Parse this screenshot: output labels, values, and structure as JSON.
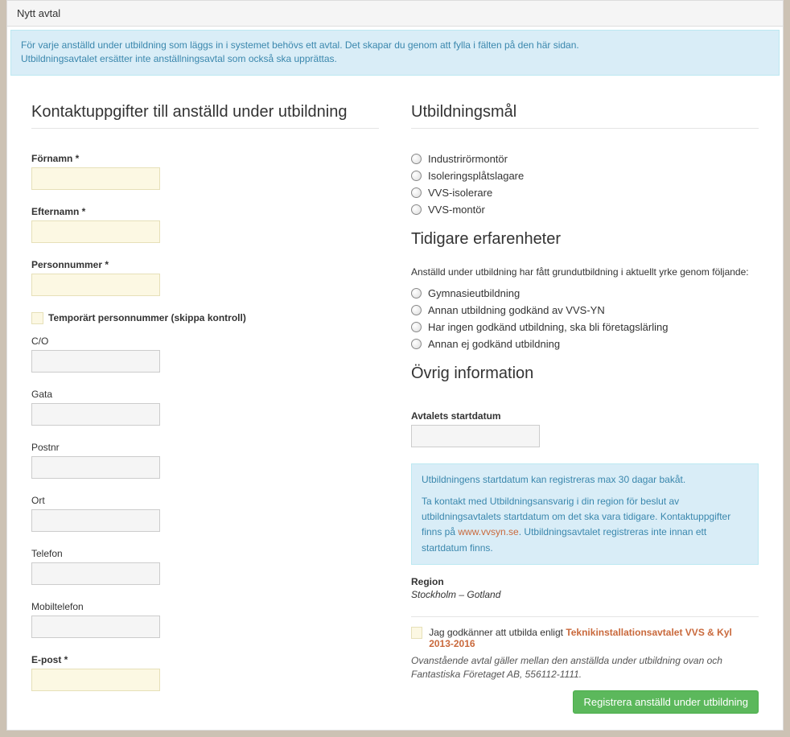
{
  "header": {
    "title": "Nytt avtal"
  },
  "infoBox": {
    "line1": "För varje anställd under utbildning som läggs in i systemet behövs ett avtal. Det skapar du genom att fylla i fälten på den här sidan.",
    "line2": "Utbildningsavtalet ersätter inte anställningsavtal som också ska upprättas."
  },
  "left": {
    "sectionTitle": "Kontaktuppgifter till anställd under utbildning",
    "fields": {
      "fornamn": "Förnamn *",
      "efternamn": "Efternamn *",
      "personnummer": "Personnummer *",
      "tempPnr": "Temporärt personnummer (skippa kontroll)",
      "co": "C/O",
      "gata": "Gata",
      "postnr": "Postnr",
      "ort": "Ort",
      "telefon": "Telefon",
      "mobil": "Mobiltelefon",
      "epost": "E-post *"
    }
  },
  "right": {
    "utbildningsmalTitle": "Utbildningsmål",
    "goals": [
      "Industrirörmontör",
      "Isoleringsplåtslagare",
      "VVS-isolerare",
      "VVS-montör"
    ],
    "tidigareTitle": "Tidigare erfarenheter",
    "tidigareHint": "Anställd under utbildning har fått grundutbildning i aktuellt yrke genom följande:",
    "experiences": [
      "Gymnasieutbildning",
      "Annan utbildning godkänd av VVS-YN",
      "Har ingen godkänd utbildning, ska bli företagslärling",
      "Annan ej godkänd utbildning"
    ],
    "ovrigTitle": "Övrig information",
    "startLabel": "Avtalets startdatum",
    "info2": {
      "line1": "Utbildningens startdatum kan registreras max 30 dagar bakåt.",
      "line2a": "Ta kontakt med Utbildningsansvarig i din region för beslut av utbildningsavtalets startdatum om det ska vara tidigare. Kontaktuppgifter finns på ",
      "link": "www.vvsyn.se",
      "line2b": ". Utbildningsavtalet registreras inte innan ett startdatum finns."
    },
    "regionLabel": "Region",
    "regionValue": "Stockholm – Gotland",
    "agreePrefix": "Jag godkänner att utbilda enligt ",
    "agreeLink": "Teknikinstallationsavtalet VVS & Kyl 2013-2016",
    "agreeSub": "Ovanstående avtal gäller mellan den anställda under utbildning ovan och Fantastiska Företaget AB, 556112-1111.",
    "submitLabel": "Registrera anställd under utbildning"
  }
}
